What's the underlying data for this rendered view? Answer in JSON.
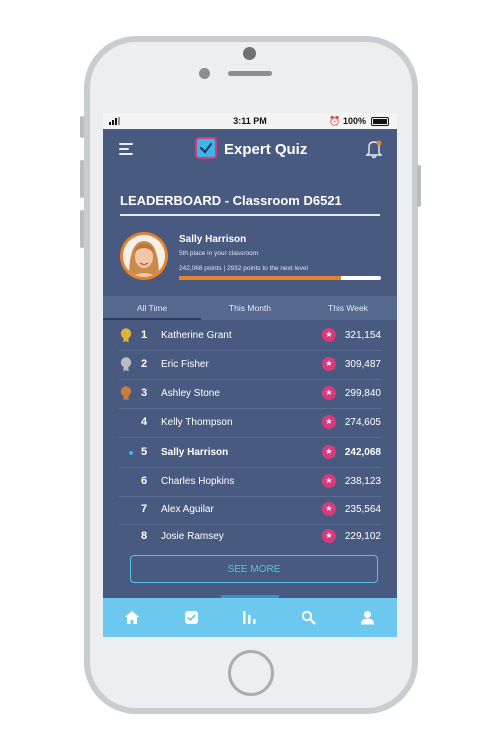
{
  "status_bar": {
    "time": "3:11 PM",
    "battery": "100%"
  },
  "app": {
    "title": "Expert Quiz"
  },
  "leaderboard": {
    "title": "LEADERBOARD - Classroom D6521"
  },
  "user": {
    "name": "Sally Harrison",
    "place": "5th place in your classroom",
    "points_text": "242,068 points | 2932 points to the next level",
    "progress": 0.8
  },
  "tabs": [
    {
      "label": "All Time",
      "active": true
    },
    {
      "label": "This Month",
      "active": false
    },
    {
      "label": "This Week",
      "active": false
    }
  ],
  "ranks": [
    {
      "rank": "1",
      "name": "Katherine Grant",
      "score": "321,154",
      "medal": "gold"
    },
    {
      "rank": "2",
      "name": "Eric Fisher",
      "score": "309,487",
      "medal": "silver"
    },
    {
      "rank": "3",
      "name": "Ashley Stone",
      "score": "299,840",
      "medal": "bronze"
    },
    {
      "rank": "4",
      "name": "Kelly Thompson",
      "score": "274,605",
      "medal": ""
    },
    {
      "rank": "5",
      "name": "Sally Harrison",
      "score": "242,068",
      "medal": "",
      "current_user": true
    },
    {
      "rank": "6",
      "name": "Charles Hopkins",
      "score": "238,123",
      "medal": ""
    },
    {
      "rank": "7",
      "name": "Alex Aguilar",
      "score": "235,564",
      "medal": ""
    },
    {
      "rank": "8",
      "name": "Josie Ramsey",
      "score": "229,102",
      "medal": ""
    }
  ],
  "see_more_label": "SEE MORE",
  "bottom_nav": [
    "home-icon",
    "checklist-icon",
    "stats-icon",
    "search-icon",
    "profile-icon"
  ],
  "colors": {
    "background": "#485a80",
    "accent_orange": "#e8812c",
    "accent_pink": "#d83a7b",
    "accent_blue": "#6cc8ee",
    "medal_gold": "#e2b13c",
    "medal_silver": "#b8bcc4",
    "medal_bronze": "#c97a3c"
  }
}
